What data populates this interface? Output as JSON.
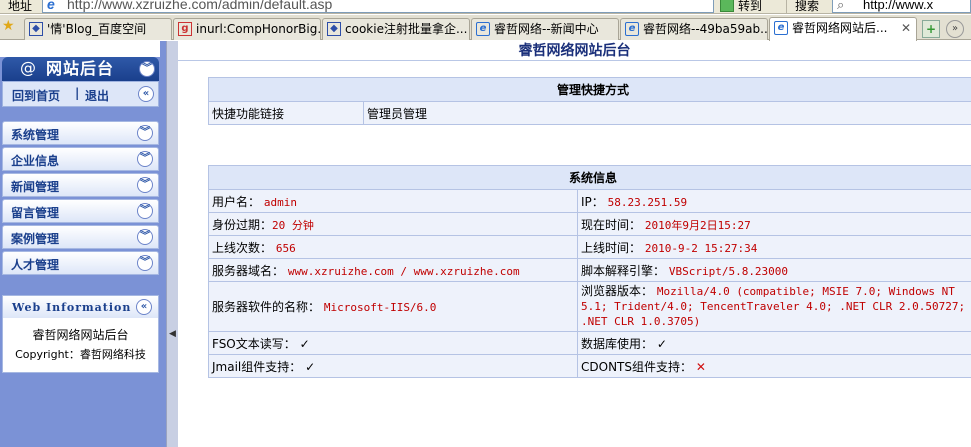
{
  "browser": {
    "address_label": "地址",
    "url": "http://www.xzruizhe.com/admin/default.asp",
    "go_label": "转到",
    "search_label": "搜索",
    "search_value": "http://www.x",
    "tabs": [
      {
        "label": "'情'Blog_百度空间",
        "icon": "paw-icon"
      },
      {
        "label": "inurl:CompHonorBig.a...",
        "icon": "google-icon"
      },
      {
        "label": "cookie注射批量拿企...",
        "icon": "paw-icon"
      },
      {
        "label": "睿哲网络--新闻中心",
        "icon": "ie-icon"
      },
      {
        "label": "睿哲网络--49ba59ab...",
        "icon": "ie-icon"
      },
      {
        "label": "睿哲网络网站后...",
        "icon": "ie-icon",
        "active": true
      }
    ]
  },
  "sidebar": {
    "header_title": "网站后台",
    "home_link": "回到首页",
    "logout_link": "退出",
    "menu": [
      {
        "label": "系统管理"
      },
      {
        "label": "企业信息"
      },
      {
        "label": "新闻管理"
      },
      {
        "label": "留言管理"
      },
      {
        "label": "案例管理"
      },
      {
        "label": "人才管理"
      }
    ],
    "info_title": "Web Information",
    "info_line1": "睿哲网络网站后台",
    "info_line2": "Copyright：睿哲网络科技"
  },
  "main": {
    "title": "睿哲网络网站后台",
    "shortcuts": {
      "title": "管理快捷方式",
      "label": "快捷功能链接",
      "value": "管理员管理"
    },
    "sysinfo": {
      "title": "系统信息",
      "rows": [
        [
          {
            "key": "用户名：",
            "value": "admin"
          },
          {
            "key": "IP：",
            "value": "58.23.251.59"
          }
        ],
        [
          {
            "key": "身份过期：",
            "value": "20 分钟"
          },
          {
            "key": "现在时间：",
            "value": "2010年9月2日15:27"
          }
        ],
        [
          {
            "key": "上线次数：",
            "value": "656"
          },
          {
            "key": "上线时间：",
            "value": "2010-9-2 15:27:34"
          }
        ],
        [
          {
            "key": "服务器域名：",
            "value": "www.xzruizhe.com / www.xzruizhe.com"
          },
          {
            "key": "脚本解释引擎：",
            "value": "VBScript/5.8.23000"
          }
        ],
        [
          {
            "key": "服务器软件的名称：",
            "value": "Microsoft-IIS/6.0"
          },
          {
            "key": "浏览器版本：",
            "value": "Mozilla/4.0 (compatible; MSIE 7.0; Windows NT 5.1; Trident/4.0; TencentTraveler 4.0; .NET CLR 2.0.50727; .NET CLR 1.0.3705)"
          }
        ],
        [
          {
            "key": "FSO文本读写：",
            "value": "✓",
            "kind": "check"
          },
          {
            "key": "数据库使用：",
            "value": "✓",
            "kind": "check"
          }
        ],
        [
          {
            "key": "Jmail组件支持：",
            "value": "✓",
            "kind": "check"
          },
          {
            "key": "CDONTS组件支持：",
            "value": "✕",
            "kind": "cross"
          }
        ]
      ]
    }
  }
}
